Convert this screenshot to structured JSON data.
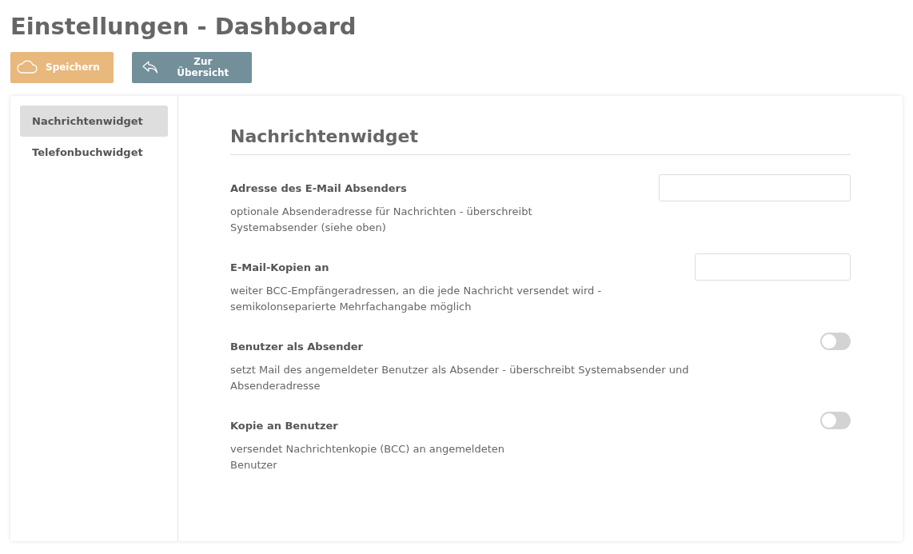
{
  "title": "Einstellungen - Dashboard",
  "buttons": [
    {
      "kind": "save",
      "label": "Speichern"
    },
    {
      "kind": "back",
      "label": "Zur Übersicht"
    }
  ],
  "sidebar": {
    "items": [
      {
        "label": "Nachrichtenwidget",
        "selected": true
      },
      {
        "label": "Telefonbuchwidget",
        "selected": false
      }
    ]
  },
  "section": {
    "heading": "Nachrichtenwidget",
    "settings": [
      {
        "kind": "text",
        "label": "Adresse des E-Mail Absenders",
        "description": "optionale Absenderadresse für Nachrichten - überschreibt\nSystemabsender (siehe oben)"
      },
      {
        "kind": "text",
        "label": "E-Mail-Kopien an",
        "description": "weiter BCC-Empfängeradressen, an die jede Nachricht versendet wird -\nsemikolonseparierte Mehrfachangabe möglich"
      },
      {
        "kind": "toggle",
        "label": "Benutzer als Absender",
        "description": "setzt Mail des angemeldeter Benutzer als Absender - überschreibt Systemabsender und\nAbsenderadresse",
        "on": false
      },
      {
        "kind": "toggle",
        "label": "Kopie an Benutzer",
        "description": "versendet Nachrichtenkopie (BCC) an angemeldeten\nBenutzer",
        "on": false
      }
    ]
  }
}
